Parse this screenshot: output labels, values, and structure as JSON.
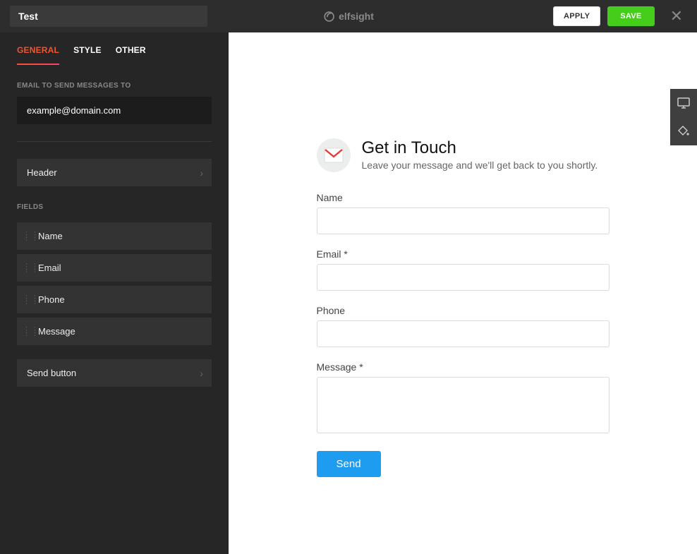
{
  "header": {
    "title_value": "Test",
    "brand": "elfsight",
    "apply_label": "APPLY",
    "save_label": "SAVE"
  },
  "sidebar": {
    "tabs": [
      {
        "label": "GENERAL",
        "active": true
      },
      {
        "label": "STYLE",
        "active": false
      },
      {
        "label": "OTHER",
        "active": false
      }
    ],
    "email_section_label": "EMAIL TO SEND MESSAGES TO",
    "email_value": "example@domain.com",
    "header_row_label": "Header",
    "fields_section_label": "FIELDS",
    "fields": [
      {
        "label": "Name"
      },
      {
        "label": "Email"
      },
      {
        "label": "Phone"
      },
      {
        "label": "Message"
      }
    ],
    "send_button_row_label": "Send button"
  },
  "preview": {
    "title": "Get in Touch",
    "subtitle": "Leave your message and we'll get back to you shortly.",
    "labels": {
      "name": "Name",
      "email": "Email *",
      "phone": "Phone",
      "message": "Message *"
    },
    "send_label": "Send"
  }
}
